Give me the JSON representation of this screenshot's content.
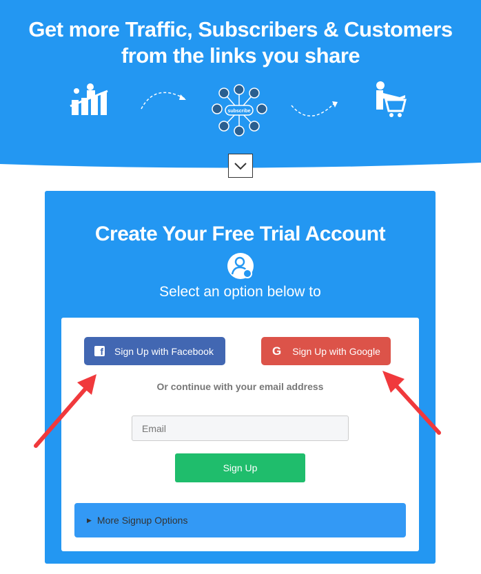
{
  "hero": {
    "title_line1": "Get more Traffic, Subscribers & Customers",
    "title_line2": "from the links you share",
    "subscribe_label": "subscribe"
  },
  "card": {
    "title": "Create Your Free Trial Account",
    "subtitle": "Select an option below to"
  },
  "form": {
    "facebook_label": "Sign Up with Facebook",
    "google_label": "Sign Up with Google",
    "or_text": "Or continue with your email address",
    "email_placeholder": "Email",
    "email_value": "",
    "signup_label": "Sign Up",
    "more_label": "More Signup Options"
  },
  "colors": {
    "brand_blue": "#2397f2",
    "facebook": "#4267b2",
    "google": "#dc5349",
    "signup": "#1fbd6c",
    "annotation_arrow": "#f0393c"
  }
}
